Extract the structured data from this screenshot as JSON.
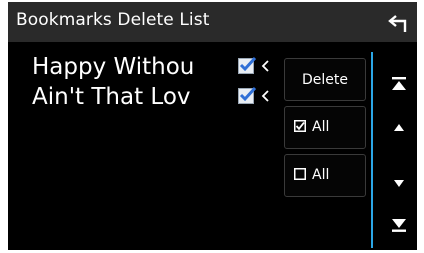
{
  "header": {
    "title": "Bookmarks Delete List",
    "back_icon": "return-arrow-icon"
  },
  "list": {
    "items": [
      {
        "label": "Happy Withou",
        "checked": true,
        "chevron_icon": "chevron-left-icon"
      },
      {
        "label": "Ain't That Lov",
        "checked": true,
        "chevron_icon": "chevron-left-icon"
      }
    ]
  },
  "actions": {
    "delete_label": "Delete",
    "select_all_label": "All",
    "deselect_all_label": "All"
  },
  "scroll": {
    "top_icon": "scroll-to-top-icon",
    "up_icon": "scroll-up-icon",
    "down_icon": "scroll-down-icon",
    "bottom_icon": "scroll-to-bottom-icon"
  },
  "colors": {
    "accent": "#2ba6e6",
    "check": "#2f6fd6",
    "title_bar": "#2a2a2a"
  }
}
